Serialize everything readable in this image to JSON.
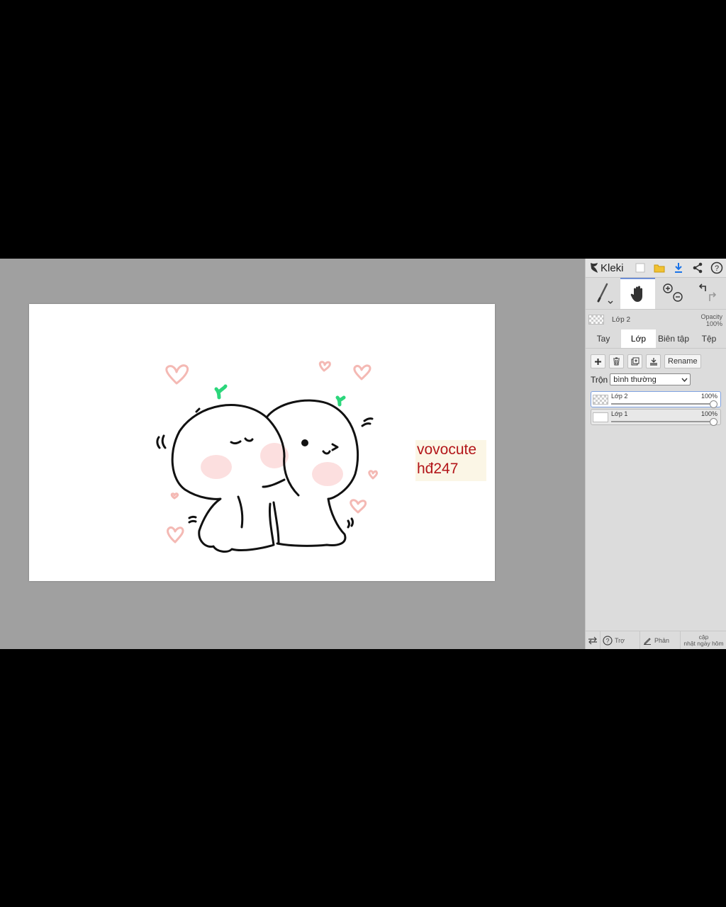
{
  "app": {
    "name": "Kleki"
  },
  "canvas": {
    "watermark_line1": "vovocute",
    "watermark_line2": "hđ247"
  },
  "toolbar": {
    "icons": [
      "new-image-icon",
      "folder-icon",
      "download-icon",
      "share-icon",
      "help-icon"
    ],
    "tools": [
      "brush-icon",
      "hand-icon",
      "zoom-icon",
      "undo-redo-icon"
    ]
  },
  "current_layer": {
    "name": "Lớp 2",
    "opacity_label": "Opacity",
    "opacity_value": "100%"
  },
  "tabs": [
    {
      "label": "Tay"
    },
    {
      "label": "Lớp"
    },
    {
      "label": "Biên tập"
    },
    {
      "label": "Tệp"
    }
  ],
  "layer_actions": {
    "rename_label": "Rename"
  },
  "blend": {
    "label": "Trộn",
    "value": "bình thường"
  },
  "layers": [
    {
      "name": "Lớp 2",
      "opacity": "100%",
      "opacity_fraction": 1.0,
      "selected": true
    },
    {
      "name": "Lớp 1",
      "opacity": "100%",
      "opacity_fraction": 1.0,
      "selected": false
    }
  ],
  "footer": {
    "help": "Trợ",
    "feedback": "Phản",
    "update_line1": "cập",
    "update_line2": "nhật ngày hôm"
  },
  "colors": {
    "accent": "#6e8fd6",
    "watermark": "#b3161a",
    "canvas_bg": "#a0a0a0",
    "panel_bg": "#dcdcdc"
  }
}
